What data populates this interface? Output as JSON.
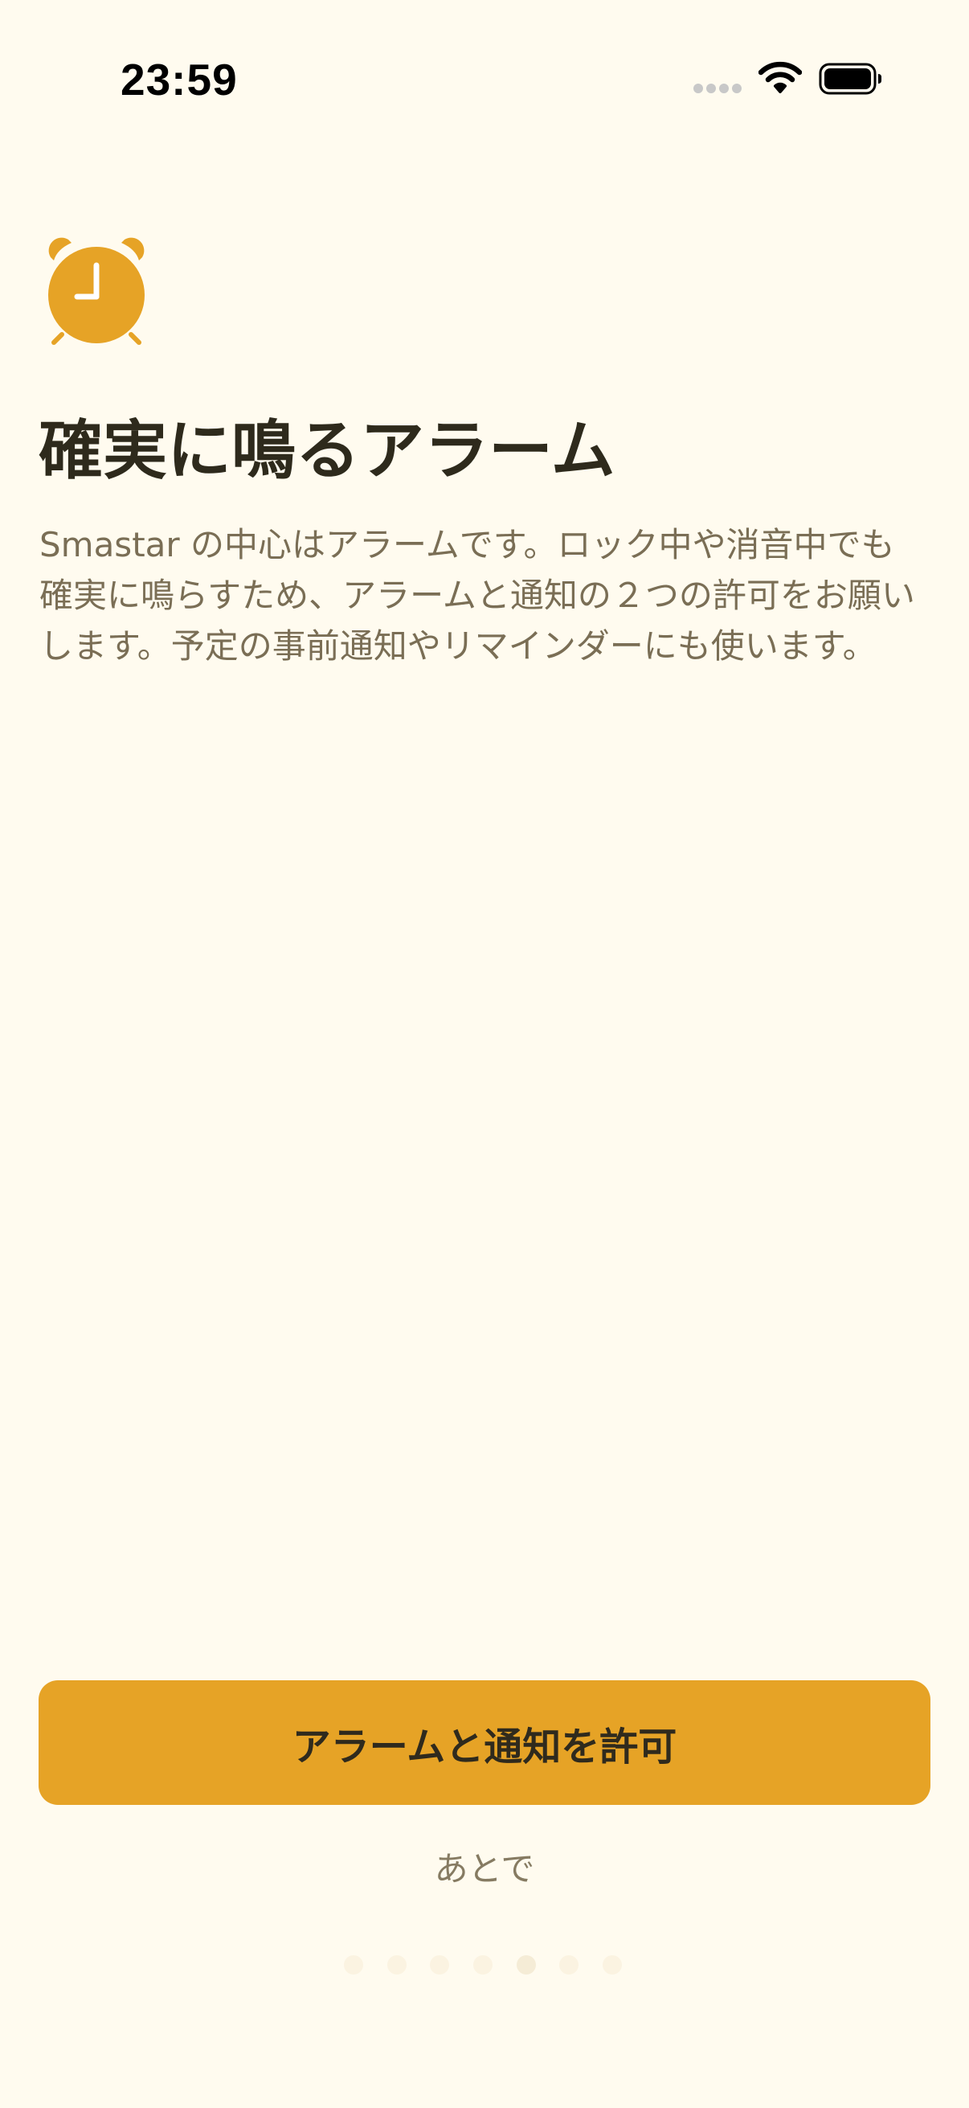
{
  "status_bar": {
    "time": "23:59",
    "icons": [
      "cellular-signal-icon",
      "wifi-icon",
      "battery-icon"
    ]
  },
  "hero_icon": "alarm-clock-icon",
  "title": "確実に鳴るアラーム",
  "description": "Smastar の中心はアラームです。ロック中や消音中でも確実に鳴らすため、アラームと通知の２つの許可をお願いします。予定の事前通知やリマインダーにも使います。",
  "primary_button": {
    "label": "アラームと通知を許可"
  },
  "secondary_link": {
    "label": "あとで"
  },
  "pagination": {
    "total_pages": 7,
    "current_page": 5
  },
  "colors": {
    "background": "#FFFBEF",
    "accent": "#E6A326",
    "title_text": "#2E2A1C",
    "body_text": "#7A6E55",
    "button_text": "#2F2A1D"
  }
}
